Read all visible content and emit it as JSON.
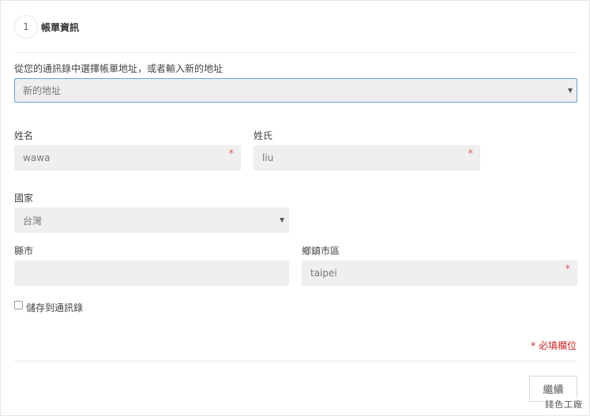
{
  "step": {
    "number": "1",
    "title": "帳單資訊"
  },
  "address_select": {
    "label": "從您的通訊錄中選擇帳單地址，或者輸入新的地址",
    "value": "新的地址"
  },
  "first_name": {
    "label": "姓名",
    "value": "wawa",
    "required_mark": "*"
  },
  "last_name": {
    "label": "姓氏",
    "value": "liu",
    "required_mark": "*"
  },
  "country": {
    "label": "國家",
    "value": "台灣"
  },
  "county": {
    "label": "縣市",
    "value": ""
  },
  "district": {
    "label": "鄉鎮市區",
    "value": "taipei",
    "required_mark": "*"
  },
  "save_to_addressbook": {
    "label": "儲存到通訊錄",
    "checked": false
  },
  "required_note": "* 必填欄位",
  "continue_button": "繼續",
  "watermark": "錢色工廠",
  "colors": {
    "required": "#e35a5a",
    "required_note": "#cc2222",
    "select_border": "#6aa5d8"
  }
}
